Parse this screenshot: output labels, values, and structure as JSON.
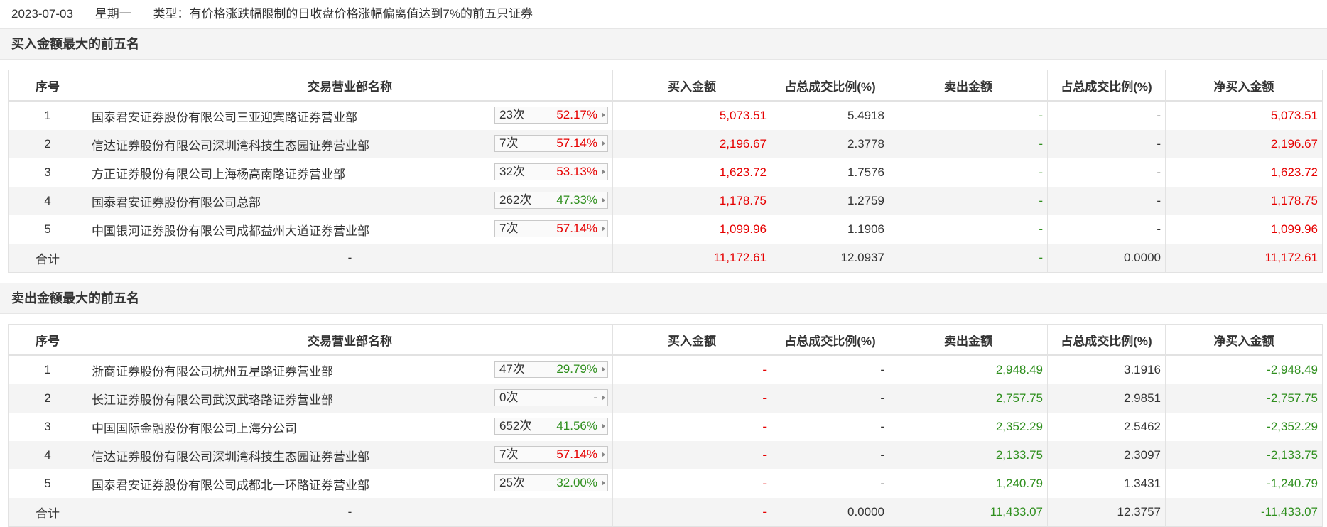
{
  "header": {
    "date": "2023-07-03",
    "weekday": "星期一",
    "type_text": "类型：有价格涨跌幅限制的日收盘价格涨幅偏离值达到7%的前五只证券"
  },
  "colors": {
    "red": "#e60000",
    "green": "#2f8f1e"
  },
  "columns": [
    "序号",
    "交易营业部名称",
    "买入金额",
    "占总成交比例(%)",
    "卖出金额",
    "占总成交比例(%)",
    "净买入金额"
  ],
  "buy_section": {
    "title": "买入金额最大的前五名",
    "rows": [
      {
        "idx": "1",
        "name": "国泰君安证券股份有限公司三亚迎宾路证券营业部",
        "count": "23次",
        "rate": "52.17%",
        "rate_color": "red",
        "buy": "5,073.51",
        "buy_pct": "5.4918",
        "sell": "-",
        "sell_pct": "-",
        "net": "5,073.51"
      },
      {
        "idx": "2",
        "name": "信达证券股份有限公司深圳湾科技生态园证券营业部",
        "count": "7次",
        "rate": "57.14%",
        "rate_color": "red",
        "buy": "2,196.67",
        "buy_pct": "2.3778",
        "sell": "-",
        "sell_pct": "-",
        "net": "2,196.67"
      },
      {
        "idx": "3",
        "name": "方正证券股份有限公司上海杨高南路证券营业部",
        "count": "32次",
        "rate": "53.13%",
        "rate_color": "red",
        "buy": "1,623.72",
        "buy_pct": "1.7576",
        "sell": "-",
        "sell_pct": "-",
        "net": "1,623.72"
      },
      {
        "idx": "4",
        "name": "国泰君安证券股份有限公司总部",
        "count": "262次",
        "rate": "47.33%",
        "rate_color": "green",
        "buy": "1,178.75",
        "buy_pct": "1.2759",
        "sell": "-",
        "sell_pct": "-",
        "net": "1,178.75"
      },
      {
        "idx": "5",
        "name": "中国银河证券股份有限公司成都益州大道证券营业部",
        "count": "7次",
        "rate": "57.14%",
        "rate_color": "red",
        "buy": "1,099.96",
        "buy_pct": "1.1906",
        "sell": "-",
        "sell_pct": "-",
        "net": "1,099.96"
      }
    ],
    "total": {
      "label": "合计",
      "name": "-",
      "buy": "11,172.61",
      "buy_pct": "12.0937",
      "sell": "-",
      "sell_pct": "0.0000",
      "net": "11,172.61"
    }
  },
  "sell_section": {
    "title": "卖出金额最大的前五名",
    "rows": [
      {
        "idx": "1",
        "name": "浙商证券股份有限公司杭州五星路证券营业部",
        "count": "47次",
        "rate": "29.79%",
        "rate_color": "green",
        "buy": "-",
        "buy_pct": "-",
        "sell": "2,948.49",
        "sell_pct": "3.1916",
        "net": "-2,948.49"
      },
      {
        "idx": "2",
        "name": "长江证券股份有限公司武汉武珞路证券营业部",
        "count": "0次",
        "rate": "-",
        "rate_color": "dark",
        "buy": "-",
        "buy_pct": "-",
        "sell": "2,757.75",
        "sell_pct": "2.9851",
        "net": "-2,757.75"
      },
      {
        "idx": "3",
        "name": "中国国际金融股份有限公司上海分公司",
        "count": "652次",
        "rate": "41.56%",
        "rate_color": "green",
        "buy": "-",
        "buy_pct": "-",
        "sell": "2,352.29",
        "sell_pct": "2.5462",
        "net": "-2,352.29"
      },
      {
        "idx": "4",
        "name": "信达证券股份有限公司深圳湾科技生态园证券营业部",
        "count": "7次",
        "rate": "57.14%",
        "rate_color": "red",
        "buy": "-",
        "buy_pct": "-",
        "sell": "2,133.75",
        "sell_pct": "2.3097",
        "net": "-2,133.75"
      },
      {
        "idx": "5",
        "name": "国泰君安证券股份有限公司成都北一环路证券营业部",
        "count": "25次",
        "rate": "32.00%",
        "rate_color": "green",
        "buy": "-",
        "buy_pct": "-",
        "sell": "1,240.79",
        "sell_pct": "1.3431",
        "net": "-1,240.79"
      }
    ],
    "total": {
      "label": "合计",
      "name": "-",
      "buy": "-",
      "buy_pct": "0.0000",
      "sell": "11,433.07",
      "sell_pct": "12.3757",
      "net": "-11,433.07"
    }
  }
}
